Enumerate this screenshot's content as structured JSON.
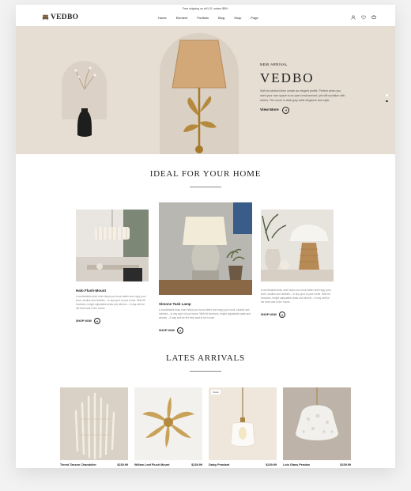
{
  "topbar": {
    "text": "Free shipping on all U.S. orders $50+"
  },
  "header": {
    "logo": "VEDBO",
    "menu": [
      "Home",
      "Element",
      "Portfolio",
      "Blog",
      "Shop",
      "Page"
    ]
  },
  "hero": {
    "eyebrow": "NEW ARRIVAL",
    "title": "VEDBO",
    "description": "Soft but distinct lines create an elegant profile. Perfect when you want your own space in an open environment, yet still socialize with others. The cover in dark gray adds elegance and style.",
    "cta": "View More"
  },
  "ideal": {
    "title": "IDEAL FOR YOUR HOME",
    "cards": [
      {
        "title": "Halo Flush-Mount",
        "description": "A comfortable desk chair helps you focus better and enjoy your work, studies and hobbies – in any spot of your home. With tilt functions, height adjustable seats and wheels – it may well be the best seat in the house.",
        "cta": "SHOP NOW"
      },
      {
        "title": "Simone Task Lamp",
        "description": "A comfortable desk chair helps you focus better and enjoy your work, studies and hobbies – in any spot of your home. With tilt functions, height adjustable seats and wheels – it may well be the best seat in the house.",
        "cta": "SHOP NOW"
      },
      {
        "title": "",
        "description": "A comfortable desk chair helps you focus better and enjoy your work, studies and hobbies – in any spot of your home. With tilt functions, height adjustable seats and wheels – it may well be the best seat in the house.",
        "cta": "SHOP NOW"
      }
    ]
  },
  "arrivals": {
    "title": "LATES ARRIVALS",
    "products": [
      {
        "name": "Tiered Tassen Chandelier",
        "price": "$239.99",
        "badge": ""
      },
      {
        "name": "Willow Leaf Flush Mount",
        "price": "$239.99",
        "badge": ""
      },
      {
        "name": "Daisy Pendant",
        "price": "$239.99",
        "badge": "SALE"
      },
      {
        "name": "Lois Glass Pendan",
        "price": "$239.99",
        "badge": ""
      }
    ]
  }
}
